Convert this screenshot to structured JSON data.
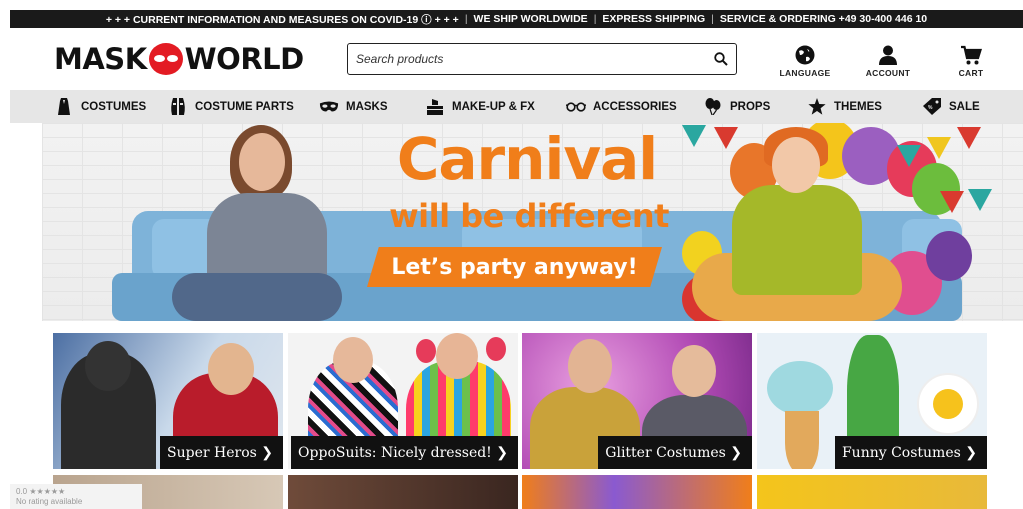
{
  "topbar": {
    "covid": "+ + + CURRENT INFORMATION AND MEASURES ON COVID-19 ⓘ + + +",
    "shipping": "WE SHIP WORLDWIDE",
    "express": "EXPRESS SHIPPING",
    "service": "SERVICE & ORDERING +49 30-400 446 10",
    "separator": "|"
  },
  "header": {
    "logo_left": "MASK",
    "logo_right": "WORLD",
    "search_placeholder": "Search products",
    "language_label": "LANGUAGE",
    "account_label": "ACCOUNT",
    "cart_label": "CART"
  },
  "nav": {
    "items": [
      {
        "label": "COSTUMES",
        "icon": "costume-icon"
      },
      {
        "label": "COSTUME PARTS",
        "icon": "costume-parts-icon"
      },
      {
        "label": "MASKS",
        "icon": "mask-icon"
      },
      {
        "label": "MAKE-UP & FX",
        "icon": "makeup-icon"
      },
      {
        "label": "ACCESSORIES",
        "icon": "glasses-icon"
      },
      {
        "label": "PROPS",
        "icon": "balloons-icon"
      },
      {
        "label": "THEMES",
        "icon": "star-icon"
      },
      {
        "label": "SALE",
        "icon": "tag-icon"
      }
    ]
  },
  "hero": {
    "title": "Carnival",
    "subtitle": "will be different",
    "ribbon": "Let’s party anyway!"
  },
  "tiles": [
    {
      "label": "Super Heros ❯"
    },
    {
      "label": "OppoSuits: Nicely dressed! ❯"
    },
    {
      "label": "Glitter Costumes ❯"
    },
    {
      "label": "Funny Costumes ❯"
    }
  ],
  "rating": {
    "score": "0.0 ★★★★★",
    "text": "No rating available"
  },
  "colors": {
    "brand_red": "#e31b23",
    "hero_orange": "#f07e1a",
    "nav_bg": "#e6e6e6",
    "topbar_bg": "#1a1a1a"
  }
}
